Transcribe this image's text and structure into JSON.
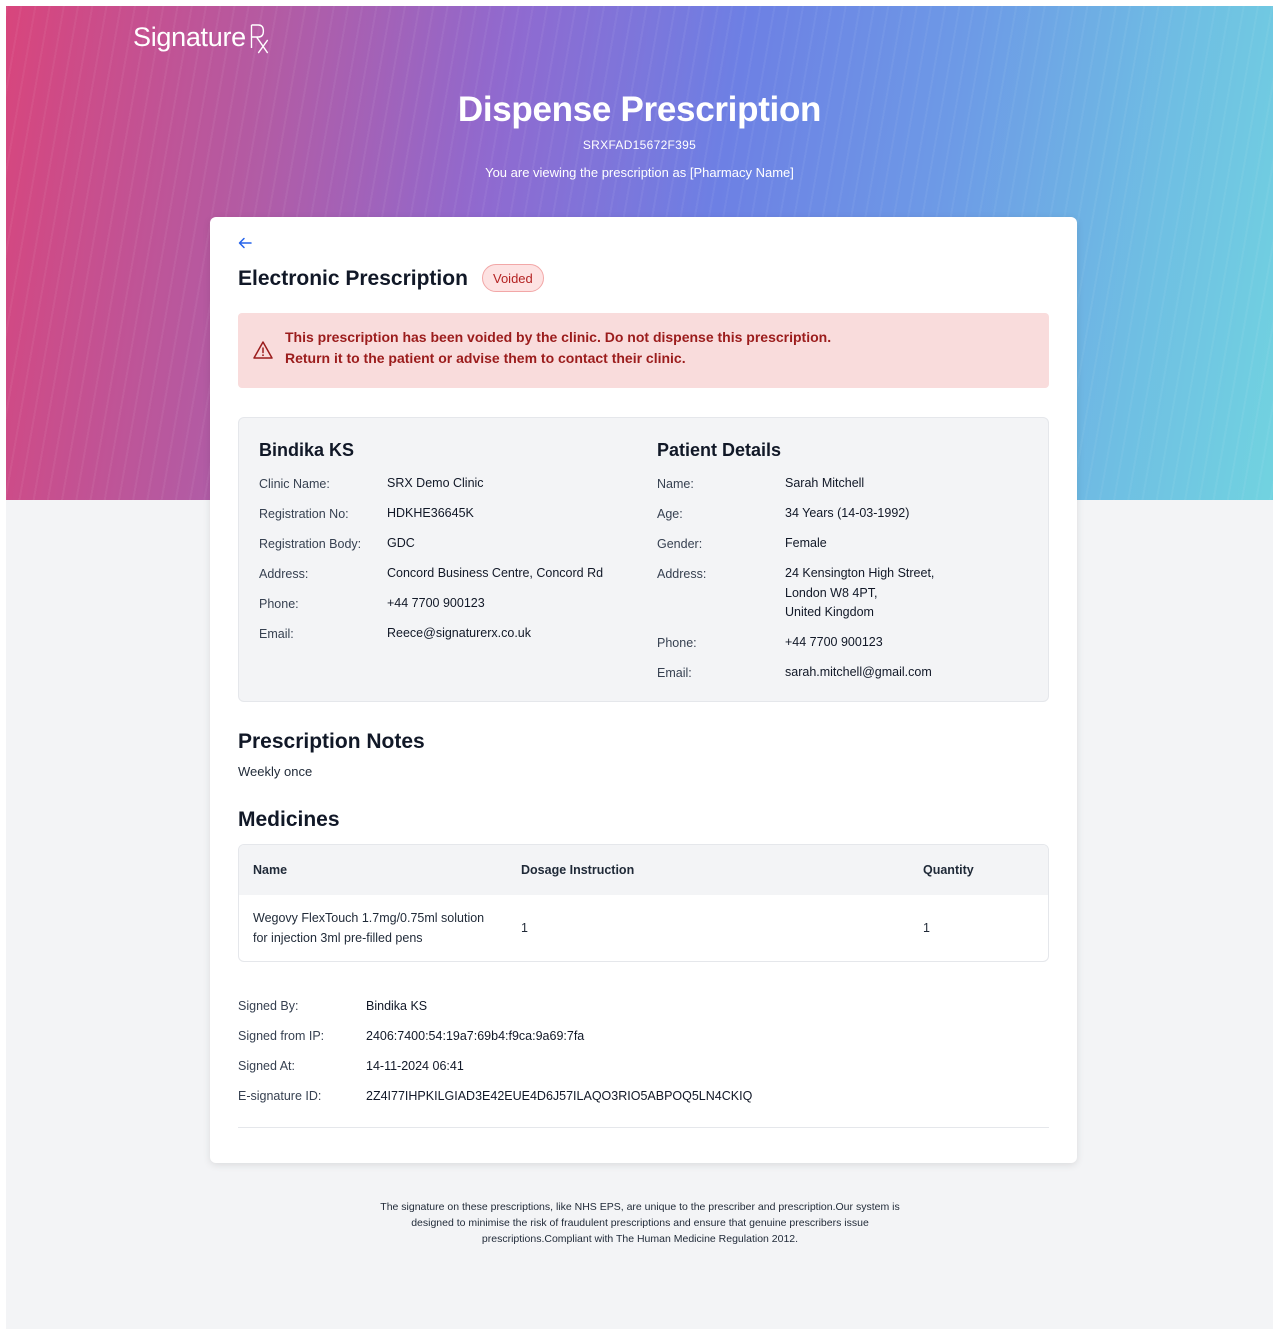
{
  "brand": {
    "logo_text": "Signature",
    "logo_rx": "Rx"
  },
  "hero": {
    "title": "Dispense Prescription",
    "prescription_id": "SRXFAD15672F395",
    "viewing_as": "You are viewing the prescription as [Pharmacy Name]"
  },
  "card": {
    "title": "Electronic Prescription",
    "status_badge": "Voided",
    "status_color": "#b42323",
    "alert": {
      "line1": "This prescription has been voided by the clinic. Do not dispense this prescription.",
      "line2": "Return it to the patient or advise them to contact their clinic."
    }
  },
  "prescriber": {
    "title": "Bindika KS",
    "fields": [
      {
        "label": "Clinic Name:",
        "value": "SRX Demo Clinic"
      },
      {
        "label": "Registration No:",
        "value": "HDKHE36645K"
      },
      {
        "label": "Registration Body:",
        "value": "GDC"
      },
      {
        "label": "Address:",
        "value": "Concord Business Centre, Concord Rd"
      },
      {
        "label": "Phone:",
        "value": "+44 7700 900123"
      },
      {
        "label": "Email:",
        "value": "Reece@signaturerx.co.uk"
      }
    ]
  },
  "patient": {
    "title": "Patient Details",
    "name_label": "Name:",
    "name": "Sarah Mitchell",
    "age_label": "Age:",
    "age": "34 Years (14-03-1992)",
    "gender_label": "Gender:",
    "gender": "Female",
    "address_label": "Address:",
    "address_line1": "24 Kensington High Street,",
    "address_line2": "London W8 4PT,",
    "address_line3": "United Kingdom",
    "phone_label": "Phone:",
    "phone": "+44 7700 900123",
    "email_label": "Email:",
    "email": "sarah.mitchell@gmail.com"
  },
  "notes": {
    "title": "Prescription Notes",
    "text": "Weekly once"
  },
  "medicines": {
    "title": "Medicines",
    "headers": {
      "name": "Name",
      "dosage": "Dosage Instruction",
      "quantity": "Quantity"
    },
    "rows": [
      {
        "name_line1": "Wegovy FlexTouch 1.7mg/0.75ml solution",
        "name_line2": "for injection 3ml pre-filled pens",
        "dosage": "1",
        "quantity": "1"
      }
    ]
  },
  "signature": {
    "signed_by_label": "Signed By:",
    "signed_by": "Bindika KS",
    "ip_label": "Signed from IP:",
    "ip": "2406:7400:54:19a7:69b4:f9ca:9a69:7fa",
    "at_label": "Signed At:",
    "at": "14-11-2024 06:41",
    "esig_label": "E-signature ID:",
    "esig": "2Z4I77IHPKILGIAD3E42EUE4D6J57ILAQO3RIO5ABPOQ5LN4CKIQ"
  },
  "footer": {
    "line1": "The signature on these prescriptions, like NHS EPS, are unique to the prescriber and prescription.Our system is",
    "line2": "designed to minimise the risk of fraudulent prescriptions and ensure that genuine prescribers issue",
    "line3": "prescriptions.Compliant with The Human Medicine Regulation 2012."
  }
}
